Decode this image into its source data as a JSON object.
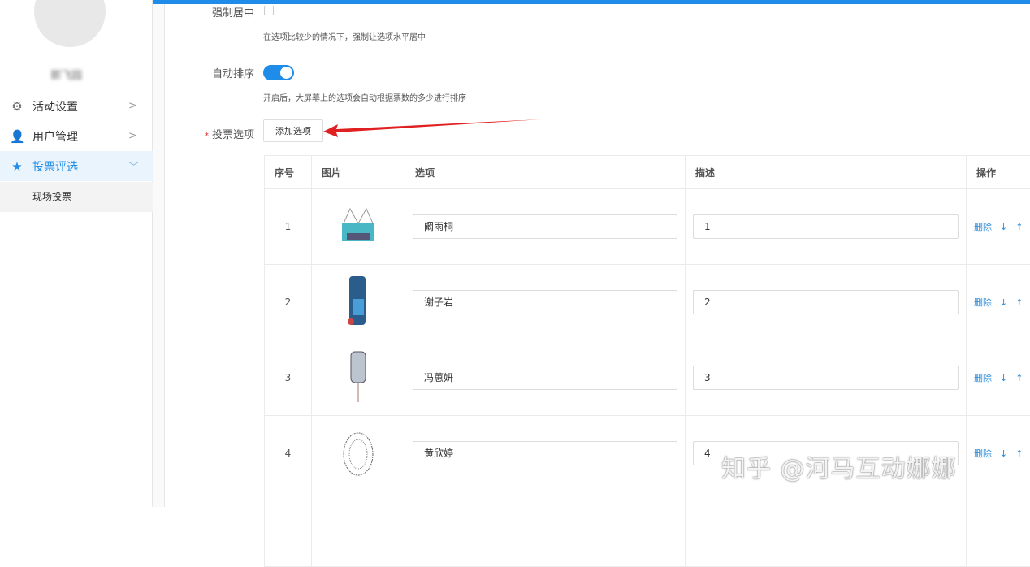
{
  "sidebar": {
    "user_name": "郭飞园",
    "items": [
      {
        "label": "活动设置",
        "icon": "gears-icon"
      },
      {
        "label": "用户管理",
        "icon": "user-icon"
      },
      {
        "label": "投票评选",
        "icon": "star-icon"
      }
    ],
    "sub_item": "现场投票"
  },
  "form": {
    "force_center": {
      "label": "强制居中",
      "checked": false,
      "help": "在选项比较少的情况下，强制让选项水平居中"
    },
    "auto_sort": {
      "label": "自动排序",
      "on": true,
      "help": "开启后，大屏幕上的选项会自动根据票数的多少进行排序"
    },
    "vote_options": {
      "required_mark": "*",
      "label": "投票选项",
      "add_button": "添加选项"
    }
  },
  "table": {
    "headers": [
      "序号",
      "图片",
      "选项",
      "描述",
      "操作"
    ],
    "rows": [
      {
        "num": "1",
        "name": "阚雨桐",
        "desc": "1"
      },
      {
        "num": "2",
        "name": "谢子岩",
        "desc": "2"
      },
      {
        "num": "3",
        "name": "冯蕙妍",
        "desc": "3"
      },
      {
        "num": "4",
        "name": "黄欣婷",
        "desc": "4"
      }
    ],
    "ops": {
      "delete": "删除",
      "down": "↓",
      "up": "↑"
    }
  },
  "watermark": "知乎 @河马互动娜娜",
  "colors": {
    "accent": "#1e8ce8",
    "arrow": "#e02020"
  }
}
